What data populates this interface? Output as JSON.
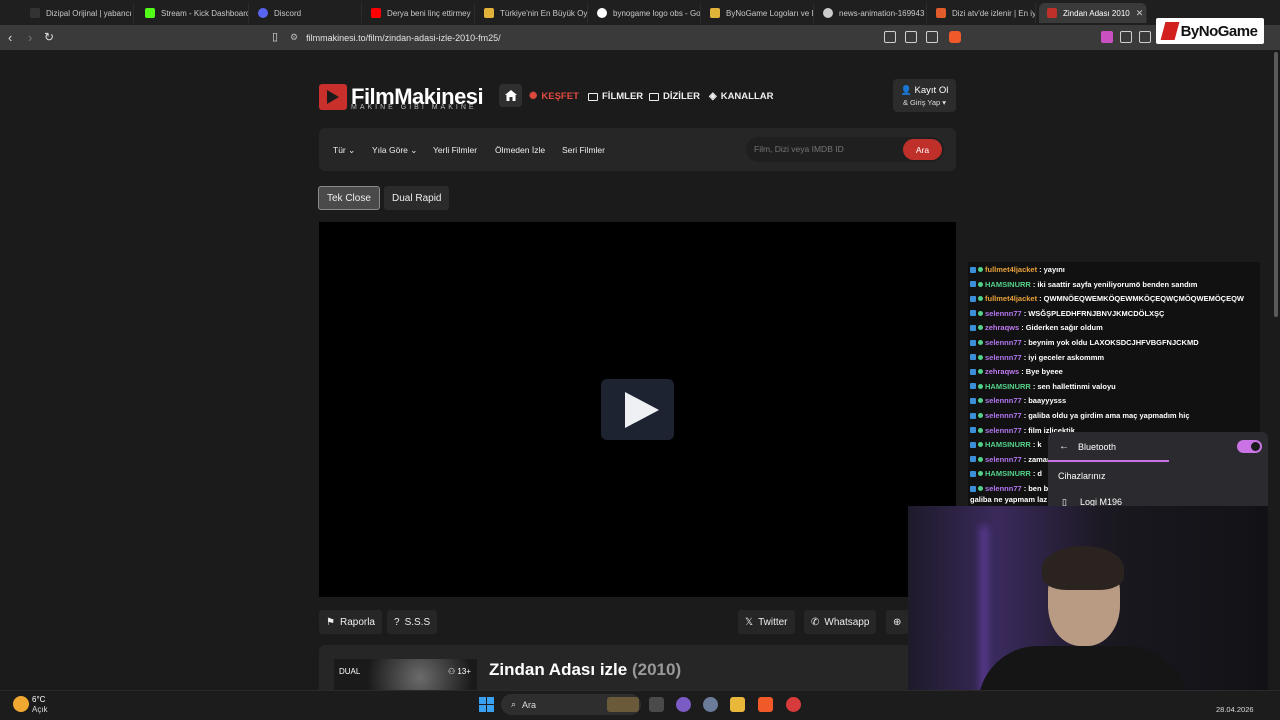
{
  "browser": {
    "tabs": [
      {
        "label": "Dizipal Orijinal | yabancı",
        "color": "#333"
      },
      {
        "label": "Stream - Kick Dashboard",
        "color": "#53fc18"
      },
      {
        "label": "Discord",
        "color": "#5865f2"
      },
      {
        "label": "Derya beni linç ettirmey",
        "color": "#ff0000"
      },
      {
        "label": "Türkiye'nin En Büyük Oy",
        "color": "#e2b33a"
      },
      {
        "label": "bynogame logo obs - Go",
        "color": "#ffffff"
      },
      {
        "label": "ByNoGame Logoları ve I",
        "color": "#e2b33a"
      },
      {
        "label": "news-animation-169943",
        "color": "#cccccc"
      },
      {
        "label": "Dizi atv'de izlenir | En iy",
        "color": "#e25b2a"
      },
      {
        "label": "Zindan Adası 2010",
        "color": "#c0302b"
      }
    ],
    "url": "filmmakinesi.to/film/zindan-adasi-izle-2010-fm25/",
    "overlay_logo": "ByNoGame"
  },
  "site": {
    "logo_name": "FilmMakinesi",
    "logo_tagline": "MAKINE GIBI MAKINE",
    "nav": {
      "kesfet": "KEŞFET",
      "filmler": "FİLMLER",
      "diziler": "DİZİLER",
      "kanallar": "KANALLAR"
    },
    "login": {
      "main": "Kayıt Ol",
      "sub": "& Giriş Yap"
    },
    "subnav": {
      "tur": "Tür",
      "yila_gore": "Yıla Göre",
      "yerli": "Yerli Filmler",
      "olmeden": "Ölmeden İzle",
      "seri": "Seri Filmler"
    },
    "search": {
      "placeholder": "Film, Dizi veya IMDB ID",
      "button": "Ara"
    },
    "sources": {
      "tek_close": "Tek Close",
      "dual_rapid": "Dual Rapid"
    },
    "actions": {
      "raporla": "Raporla",
      "sss": "S.S.S",
      "twitter": "Twitter",
      "whatsapp": "Whatsapp"
    },
    "movie": {
      "badge": "DUAL",
      "age": "13+",
      "title": "Zindan Adası izle",
      "year": "(2010)"
    }
  },
  "chat": {
    "messages": [
      {
        "user": "fullmet4ljacket",
        "text": "yayını",
        "color": "#e8a13a"
      },
      {
        "user": "HAMSINURR",
        "text": "iki saattir sayfa yeniliyorumö benden sandım",
        "color": "#53d38a"
      },
      {
        "user": "fullmet4ljacket",
        "text": "QWMNÖEQWEMKÖQEWMKÖÇEQWÇMÖQWEMÖÇEQW",
        "color": "#e8a13a"
      },
      {
        "user": "selennn77",
        "text": "WSĞŞPLEDHFRNJBNVJKMCDÖLXŞÇ",
        "color": "#b277f0"
      },
      {
        "user": "zehraqws",
        "text": "Giderken sağır oldum",
        "color": "#c07af0"
      },
      {
        "user": "selennn77",
        "text": "beynim yok oldu LAXOKSDCJHFVBGFNJCKMD",
        "color": "#b277f0"
      },
      {
        "user": "selennn77",
        "text": "iyi geceler askommm",
        "color": "#b277f0"
      },
      {
        "user": "zehraqws",
        "text": "Bye byeee",
        "color": "#c07af0"
      },
      {
        "user": "HAMSINURR",
        "text": "sen hallettinmi valoyu",
        "color": "#53d38a"
      },
      {
        "user": "selennn77",
        "text": "baayyysss",
        "color": "#b277f0"
      },
      {
        "user": "selennn77",
        "text": "galiba oldu ya girdim ama maç yapmadım hiç",
        "color": "#b277f0"
      },
      {
        "user": "selennn77",
        "text": "film izlicektik",
        "color": "#b277f0"
      },
      {
        "user": "HAMSINURR",
        "text": "k",
        "color": "#53d38a"
      },
      {
        "user": "selennn77",
        "text": "zamar",
        "color": "#b277f0"
      },
      {
        "user": "HAMSINURR",
        "text": "d",
        "color": "#53d38a"
      },
      {
        "user": "selennn77",
        "text": "ben bu",
        "color": "#b277f0"
      }
    ],
    "wrap_line": "galiba ne yapmam laz"
  },
  "bluetooth": {
    "title": "Bluetooth",
    "section": "Cihazlarınız",
    "device": "Logi M196",
    "enabled": true,
    "accent": "#c973e4"
  },
  "taskbar": {
    "temp": "6°C",
    "weather": "Açık",
    "search": "Ara",
    "date": "28.04.2026"
  }
}
